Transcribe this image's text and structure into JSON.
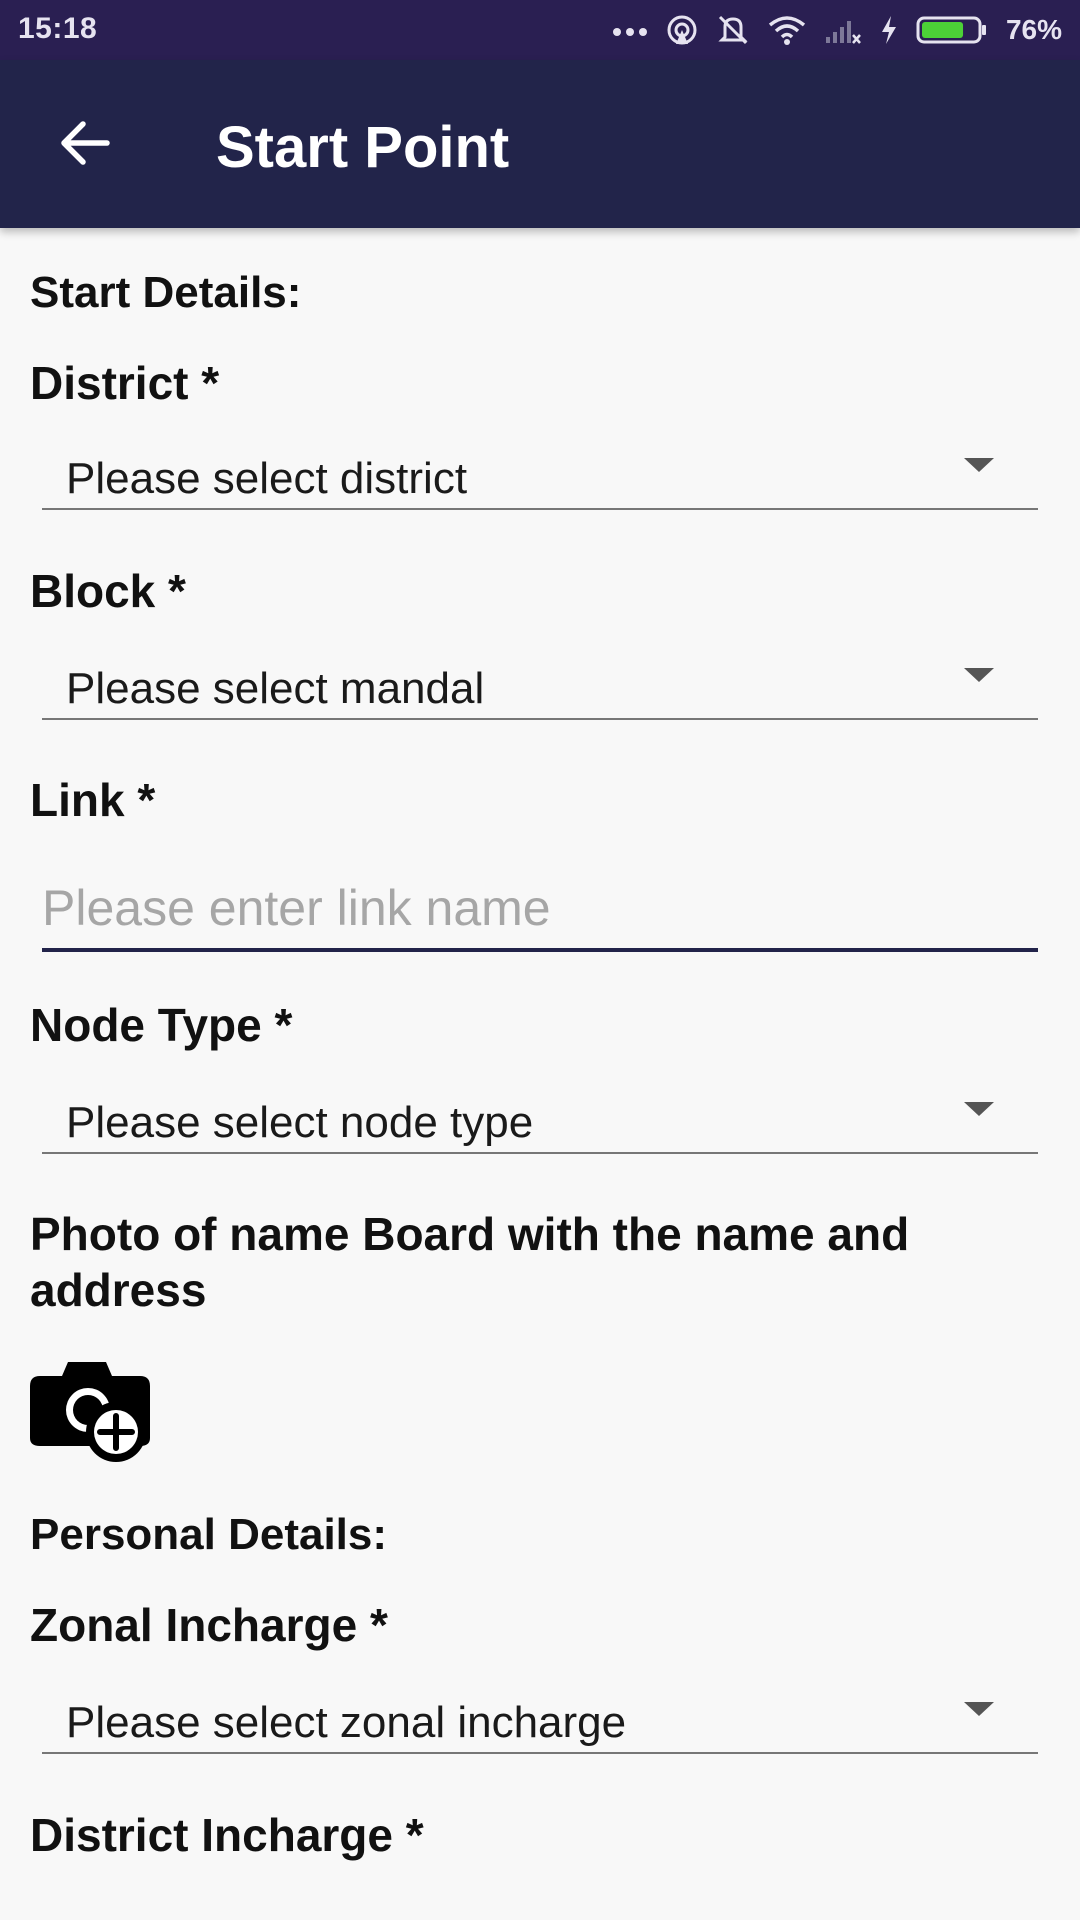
{
  "status_bar": {
    "time": "15:18",
    "battery_percent": "76%",
    "icons": [
      "more-dots-icon",
      "hotspot-icon",
      "mute-bell-icon",
      "wifi-icon",
      "signal-icon",
      "charging-icon",
      "battery-icon"
    ],
    "battery_level": 0.76
  },
  "app_bar": {
    "title": "Start Point",
    "back_icon": "back-arrow-icon"
  },
  "form": {
    "start_section_title": "Start Details:",
    "district_label": "District *",
    "district_value": "Please select district",
    "block_label": "Block *",
    "block_value": "Please select mandal",
    "link_label": "Link *",
    "link_placeholder": "Please enter link name",
    "link_value": "",
    "node_type_label": "Node Type *",
    "node_type_value": "Please select node type",
    "photo_label": "Photo of name Board with the name and address",
    "camera_icon": "add-photo-camera-icon",
    "personal_section_title": "Personal Details:",
    "zonal_label": "Zonal Incharge *",
    "zonal_value": "Please select zonal incharge",
    "district_incharge_label": "District Incharge *"
  },
  "colors": {
    "status_bar": "#2a1f52",
    "app_bar": "#22244a",
    "background": "#f8f8f8",
    "battery_fill": "#4cd137",
    "input_underline_active": "#22244a"
  }
}
